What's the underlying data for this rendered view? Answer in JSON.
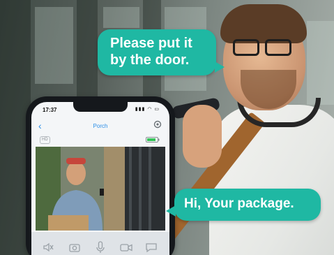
{
  "speech": {
    "customer_line1": "Please put it",
    "customer_line2": "by the door.",
    "visitor": "Hi, Your package."
  },
  "phone": {
    "time": "17:37",
    "camera_name": "Porch",
    "stream_badge": "HD",
    "icons": {
      "back": "chevron-left-icon",
      "settings": "gear-icon",
      "signal": "signal-icon",
      "wifi": "wifi-icon",
      "battery": "battery-icon",
      "mute": "mute-icon",
      "snapshot": "camera-icon",
      "talk": "microphone-icon",
      "record": "video-icon",
      "quick_reply": "message-icon"
    }
  },
  "colors": {
    "bubble": "#1fb8a3",
    "accent": "#2a8ee8",
    "battery_level": "#37c35a"
  }
}
